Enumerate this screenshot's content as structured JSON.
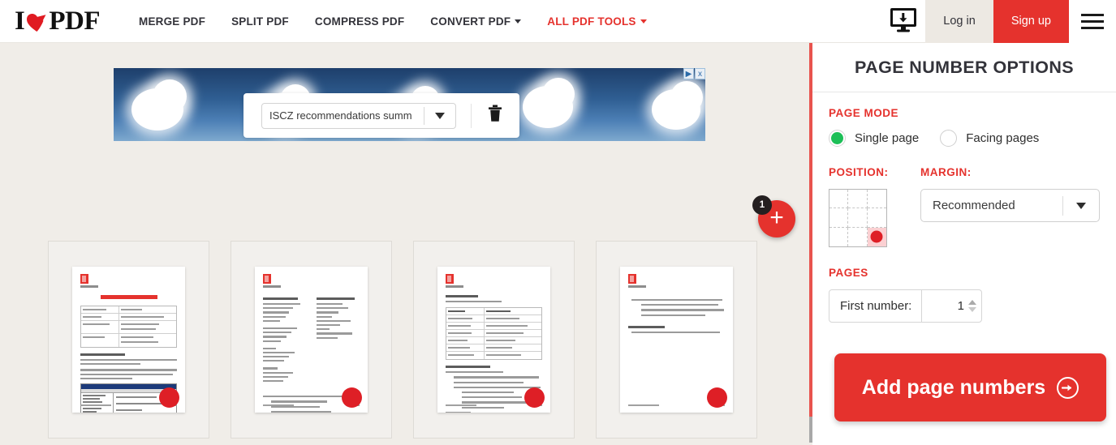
{
  "header": {
    "logo": {
      "i": "I",
      "heart_icon": "heart-icon",
      "pdf": "PDF"
    },
    "nav": [
      {
        "label": "MERGE PDF",
        "has_caret": false,
        "red": false
      },
      {
        "label": "SPLIT PDF",
        "has_caret": false,
        "red": false
      },
      {
        "label": "COMPRESS PDF",
        "has_caret": false,
        "red": false
      },
      {
        "label": "CONVERT PDF",
        "has_caret": true,
        "red": false
      },
      {
        "label": "ALL PDF TOOLS",
        "has_caret": true,
        "red": true
      }
    ],
    "desktop_icon": "monitor-download-icon",
    "login_label": "Log in",
    "signup_label": "Sign up",
    "menu_icon": "hamburger-menu-icon"
  },
  "toolbar": {
    "file_name": "ISCZ recommendations summ",
    "dropdown_icon": "chevron-down-icon",
    "delete_icon": "trash-icon"
  },
  "ad": {
    "adchoices_icon": "adchoices-triangle-icon",
    "close_icon": "x"
  },
  "add_files": {
    "plus_icon": "plus-icon",
    "badge_count": "1"
  },
  "thumbnails": [
    {
      "name": "page-thumbnail-1",
      "page_number_marker": "red-dot"
    },
    {
      "name": "page-thumbnail-2",
      "page_number_marker": "red-dot"
    },
    {
      "name": "page-thumbnail-3",
      "page_number_marker": "red-dot"
    },
    {
      "name": "page-thumbnail-4",
      "page_number_marker": "red-dot"
    }
  ],
  "panel": {
    "title": "PAGE NUMBER OPTIONS",
    "page_mode": {
      "label": "PAGE MODE",
      "options": [
        {
          "label": "Single page",
          "selected": true
        },
        {
          "label": "Facing pages",
          "selected": false
        }
      ]
    },
    "position": {
      "label": "POSITION:",
      "grid_rows": 3,
      "grid_cols": 3,
      "selected_cell": "bottom-right"
    },
    "margin": {
      "label": "MARGIN:",
      "value": "Recommended",
      "dropdown_icon": "chevron-down-icon"
    },
    "pages": {
      "label": "PAGES",
      "first_number_label": "First number:",
      "first_number_value": "1",
      "spinner_icon": "spinner-up-down-icon"
    },
    "cta": {
      "label": "Add page numbers",
      "arrow_icon": "arrow-right-circle-icon"
    }
  },
  "colors": {
    "brand_red": "#E5322D",
    "page_dot_red": "#DE1F26",
    "radio_green": "#1CBF57",
    "workspace_bg": "#F0EDE8",
    "divider_red": "#E8534E"
  }
}
